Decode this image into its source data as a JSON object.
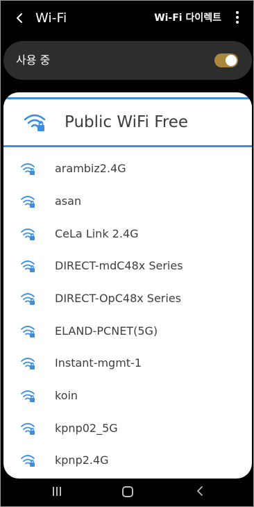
{
  "header": {
    "back_icon": "chevron-left-icon",
    "title": "Wi-Fi",
    "direct_label": "Wi-Fi 다이렉트",
    "more_icon": "more-vertical-icon"
  },
  "toggle": {
    "label": "사용 중",
    "on": true,
    "accent": "#a8883e"
  },
  "highlighted_network": {
    "name": "Public WiFi Free",
    "icon": "wifi-lock-icon",
    "border_color": "#3d8fdd"
  },
  "networks": [
    {
      "name": "arambiz2.4G",
      "icon": "wifi-lock-icon"
    },
    {
      "name": "asan",
      "icon": "wifi-lock-icon"
    },
    {
      "name": "CeLa Link 2.4G",
      "icon": "wifi-lock-icon"
    },
    {
      "name": "DIRECT-mdC48x Series",
      "icon": "wifi-lock-icon"
    },
    {
      "name": "DIRECT-OpC48x Series",
      "icon": "wifi-lock-icon"
    },
    {
      "name": "ELAND-PCNET(5G)",
      "icon": "wifi-lock-icon"
    },
    {
      "name": "Instant-mgmt-1",
      "icon": "wifi-lock-icon"
    },
    {
      "name": "koin",
      "icon": "wifi-lock-icon"
    },
    {
      "name": "kpnp02_5G",
      "icon": "wifi-lock-icon"
    },
    {
      "name": "kpnp2.4G",
      "icon": "wifi-lock-icon"
    }
  ],
  "navbar": {
    "recents_icon": "recents-icon",
    "home_icon": "home-icon",
    "back_icon": "back-icon"
  }
}
